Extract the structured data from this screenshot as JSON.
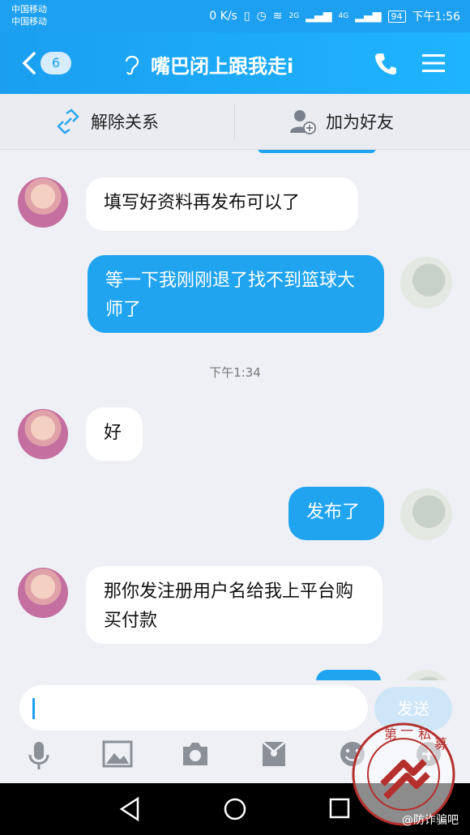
{
  "status_bar": {
    "carrier_line1": "中国移动",
    "carrier_line2": "中国移动",
    "speed": "0 K/s",
    "signal_2g": "2G",
    "signal_4g": "4G",
    "battery": "94",
    "time": "下午1:56"
  },
  "header": {
    "unread_count": "6",
    "title": "嘴巴闭上跟我走i"
  },
  "actions": {
    "unlink_label": "解除关系",
    "add_friend_label": "加为好友"
  },
  "messages": {
    "m1": "填写好资料再发布可以了",
    "m2": "等一下我刚刚退了找不到篮球大师了",
    "timestamp": "下午1:34",
    "m3": "好",
    "m4": "发布了",
    "m5": "那你发注册用户名给我上平台购买付款"
  },
  "composer": {
    "input_value": "",
    "send_label": "发送"
  },
  "watermark": {
    "seal_text": "第一私募",
    "caption": "@防诈骗吧"
  },
  "colors": {
    "accent": "#1ea0f0",
    "outgoing_bubble": "#20a4f0",
    "incoming_bubble": "#ffffff",
    "background": "#eef0f5",
    "seal": "#b5302d"
  }
}
